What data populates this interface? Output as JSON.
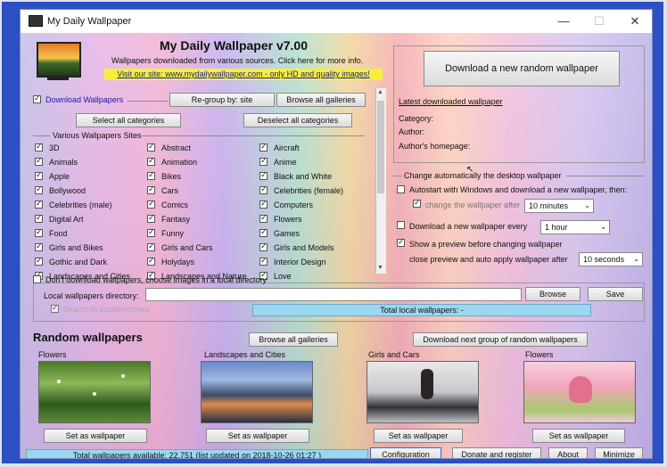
{
  "window": {
    "title": "My Daily Wallpaper",
    "controls": {
      "minimize": "—",
      "maximize": "☐",
      "close": "✕"
    }
  },
  "header": {
    "app_title": "My Daily Wallpaper v7.00",
    "subtitle": "Wallpapers downloaded from various sources. Click here for more info.",
    "site_link": "Visit our site: www.mydailywallpaper.com - only HD and quality images!"
  },
  "download": {
    "checkbox_label": "Download Wallpapers",
    "regroup_button": "Re-group by: site",
    "browse_all_button": "Browse all galleries",
    "select_all_button": "Select all categories",
    "deselect_all_button": "Deselect all categories",
    "group_title": "Various Wallpapers Sites",
    "categories": [
      [
        "3D",
        "Abstract",
        "Aircraft"
      ],
      [
        "Animals",
        "Animation",
        "Anime"
      ],
      [
        "Apple",
        "Bikes",
        "Black and White"
      ],
      [
        "Bollywood",
        "Cars",
        "Celebrities (female)"
      ],
      [
        "Celebrities (male)",
        "Comics",
        "Computers"
      ],
      [
        "Digital Art",
        "Fantasy",
        "Flowers"
      ],
      [
        "Food",
        "Funny",
        "Games"
      ],
      [
        "Girls and Bikes",
        "Girls and Cars",
        "Girls and Models"
      ],
      [
        "Gothic and Dark",
        "Holydays",
        "Interior Design"
      ],
      [
        "Landscapes and Cities",
        "Landscapes and Nature",
        "Love"
      ]
    ]
  },
  "right_panel": {
    "download_random_button": "Download a new random wallpaper",
    "latest_label": "Latest downloaded wallpaper",
    "category_label": "Category:",
    "author_label": "Author:",
    "homepage_label": "Author's homepage:",
    "auto_group_title": "Change automatically the desktop wallpaper",
    "autostart_label": "Autostart with Windows and download a new wallpaper, then:",
    "change_after_label": "change the wallpaper after",
    "change_after_value": "10 minutes",
    "download_every_label": "Download a new wallpaper every",
    "download_every_value": "1 hour",
    "preview_label": "Show a preview before changing wallpaper",
    "close_preview_label": "close preview and auto apply wallpaper after",
    "close_preview_value": "10 seconds"
  },
  "local": {
    "dont_download_label": "Don't download wallpapers, choose images in a local directory",
    "directory_label": "Local wallpapers directory:",
    "directory_value": "",
    "browse_button": "Browse",
    "save_button": "Save",
    "search_subdirs_label": "Search in subdirectories",
    "total_local": "Total local wallpapers: -"
  },
  "random": {
    "title": "Random wallpapers",
    "browse_all_button": "Browse all galleries",
    "next_group_button": "Download next group of random wallpapers",
    "items": [
      {
        "caption": "Flowers",
        "button": "Set as wallpaper"
      },
      {
        "caption": "Landscapes and Cities",
        "button": "Set as wallpaper"
      },
      {
        "caption": "Girls and Cars",
        "button": "Set as wallpaper"
      },
      {
        "caption": "Flowers",
        "button": "Set as wallpaper"
      }
    ]
  },
  "footer": {
    "status": "Total wallpapers available: 22.751 (list updated on 2018-10-26 01:27 )",
    "configuration_button": "Configuration",
    "donate_button": "Donate and register",
    "about_button": "About",
    "minimize_button": "Minimize"
  },
  "colors": {
    "frame_blue": "#2d4fc4",
    "status_blue": "#9ad7f0",
    "link_blue": "#1a1aa8",
    "site_banner_yellow": "#f6f03a"
  }
}
